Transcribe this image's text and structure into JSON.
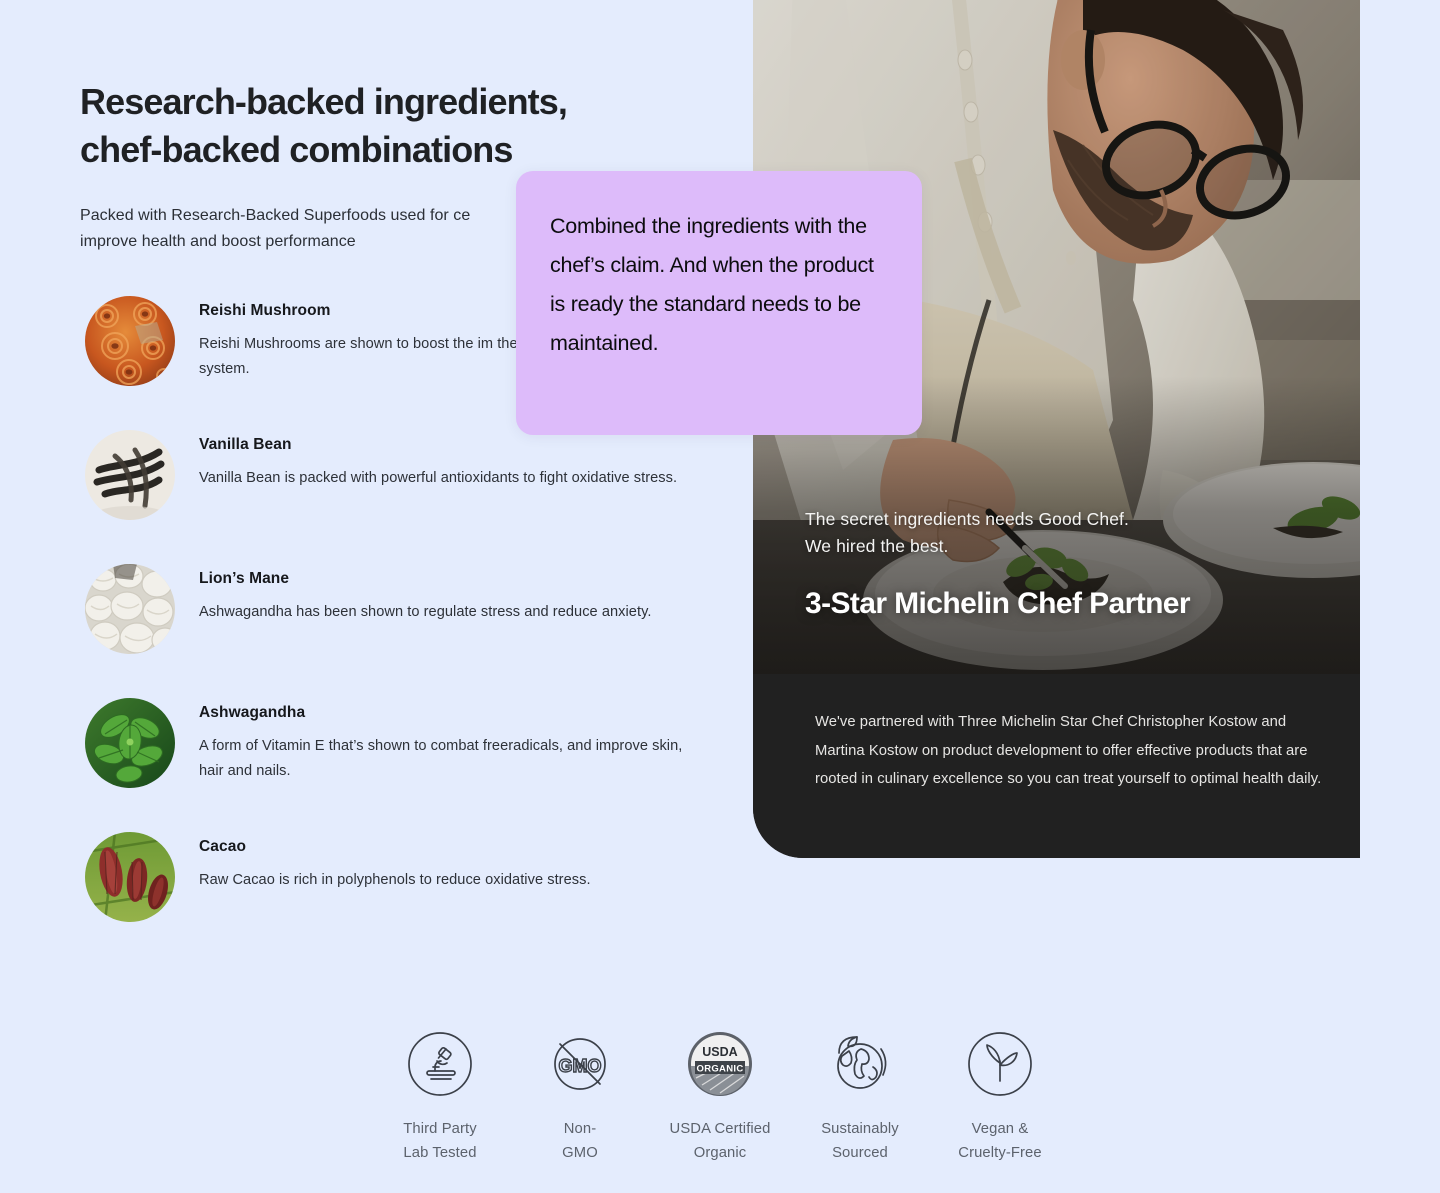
{
  "page": {
    "background_color": "#e4ecfd"
  },
  "left": {
    "headline": "Research-backed ingredients,\nchef-backed combinations",
    "subhead": "Packed with Research-Backed Superfoods used for ce\nimprove health and boost performance"
  },
  "ingredients": [
    {
      "name": "Reishi Mushroom",
      "description": "Reishi Mushrooms are shown to boost the im\nthe body and calm the nervous system.",
      "image": "reishi-mushroom-photo"
    },
    {
      "name": "Vanilla Bean",
      "description": "Vanilla Bean is packed with powerful antioxidants to fight oxidative\nstress.",
      "image": "vanilla-bean-photo"
    },
    {
      "name": "Lion’s Mane",
      "description": "Ashwagandha has been shown to regulate stress and reduce\nanxiety.",
      "image": "lions-mane-photo"
    },
    {
      "name": "Ashwagandha",
      "description": "A form of Vitamin E that’s shown to combat freeradicals, and\nimprove skin, hair and nails.",
      "image": "ashwagandha-leaf-photo"
    },
    {
      "name": "Cacao",
      "description": "Raw Cacao is rich in polyphenols to reduce oxidative stress.",
      "image": "cacao-pod-photo"
    }
  ],
  "callout": {
    "text": "Combined the ingredients with the chef’s claim. And when the product is ready the standard needs to be maintained.",
    "background_color": "#ddbbfa",
    "text_color": "#0c0c0e"
  },
  "chef_panel": {
    "photo": "chef-plating-dish-photo",
    "kicker": "The secret ingredients needs  Good Chef.\nWe hired the best.",
    "title": "3-Star Michelin Chef Partner",
    "paragraph": "We've partnered with Three Michelin Star Chef Christopher Kostow and Martina Kostow on product development to offer effective products that are rooted in culinary excellence so you can treat yourself to optimal health daily.",
    "background_color": "#212121"
  },
  "badges": [
    {
      "icon": "microscope-icon",
      "label": "Third Party\nLab Tested"
    },
    {
      "icon": "non-gmo-icon",
      "label": "Non-\nGMO"
    },
    {
      "icon": "usda-organic-icon",
      "label": "USDA Certified\nOrganic"
    },
    {
      "icon": "globe-leaf-icon",
      "label": "Sustainably\nSourced"
    },
    {
      "icon": "vegan-sprout-icon",
      "label": "Vegan &\nCruelty-Free"
    }
  ]
}
